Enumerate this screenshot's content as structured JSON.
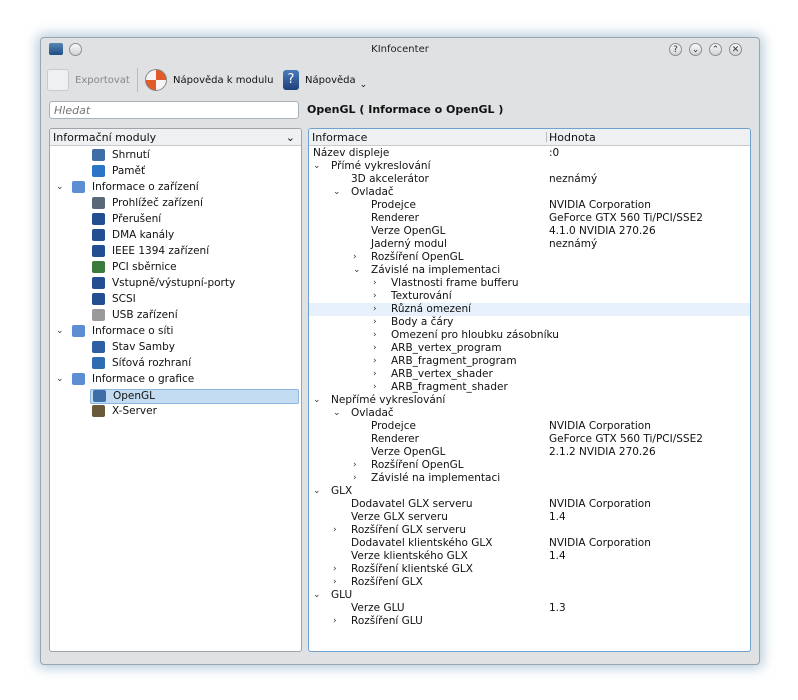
{
  "window": {
    "title": "KInfocenter"
  },
  "toolbar": {
    "export": "Exportovat",
    "module_help": "Nápověda k modulu",
    "help": "Nápověda"
  },
  "search": {
    "placeholder": "Hledat"
  },
  "page_title": "OpenGL  ( Informace o OpenGL )",
  "left": {
    "header": "Informační moduly",
    "items": [
      {
        "label": "Shrnutí",
        "level": 1,
        "icon": "monitor-icon"
      },
      {
        "label": "Paměť",
        "level": 1,
        "icon": "memory-icon"
      },
      {
        "label": "Informace o zařízení",
        "level": 0,
        "icon": "folder-icon",
        "expanded": true
      },
      {
        "label": "Prohlížeč zařízení",
        "level": 1,
        "icon": "device-icon"
      },
      {
        "label": "Přerušení",
        "level": 1,
        "icon": "info-icon"
      },
      {
        "label": "DMA kanály",
        "level": 1,
        "icon": "info-icon"
      },
      {
        "label": "IEEE 1394 zařízení",
        "level": 1,
        "icon": "info-icon"
      },
      {
        "label": "PCI sběrnice",
        "level": 1,
        "icon": "pci-icon"
      },
      {
        "label": "Vstupně/výstupní-porty",
        "level": 1,
        "icon": "info-icon"
      },
      {
        "label": "SCSI",
        "level": 1,
        "icon": "info-icon"
      },
      {
        "label": "USB zařízení",
        "level": 1,
        "icon": "usb-icon"
      },
      {
        "label": "Informace o síti",
        "level": 0,
        "icon": "folder-icon",
        "expanded": true
      },
      {
        "label": "Stav Samby",
        "level": 1,
        "icon": "samba-icon"
      },
      {
        "label": "Síťová rozhraní",
        "level": 1,
        "icon": "network-icon"
      },
      {
        "label": "Informace o grafice",
        "level": 0,
        "icon": "folder-icon",
        "expanded": true
      },
      {
        "label": "OpenGL",
        "level": 1,
        "icon": "monitor-icon",
        "selected": true
      },
      {
        "label": "X-Server",
        "level": 1,
        "icon": "x-icon"
      }
    ]
  },
  "right": {
    "col_info": "Informace",
    "col_value": "Hodnota",
    "rows": [
      {
        "label": "Název displeje",
        "value": ":0",
        "level": 0,
        "exp": ""
      },
      {
        "label": "Přímé vykreslování",
        "value": "",
        "level": 0,
        "exp": "v"
      },
      {
        "label": "3D akcelerátor",
        "value": "neznámý",
        "level": 1,
        "exp": ""
      },
      {
        "label": "Ovladač",
        "value": "",
        "level": 1,
        "exp": "v"
      },
      {
        "label": "Prodejce",
        "value": "NVIDIA Corporation",
        "level": 2,
        "exp": ""
      },
      {
        "label": "Renderer",
        "value": "GeForce GTX 560 Ti/PCI/SSE2",
        "level": 2,
        "exp": ""
      },
      {
        "label": "Verze OpenGL",
        "value": "4.1.0 NVIDIA 270.26",
        "level": 2,
        "exp": ""
      },
      {
        "label": "Jaderný modul",
        "value": "neznámý",
        "level": 2,
        "exp": ""
      },
      {
        "label": "Rozšíření OpenGL",
        "value": "",
        "level": 2,
        "exp": ">"
      },
      {
        "label": "Závislé na implementaci",
        "value": "",
        "level": 2,
        "exp": "v"
      },
      {
        "label": "Vlastnosti frame bufferu",
        "value": "",
        "level": 3,
        "exp": ">"
      },
      {
        "label": "Texturování",
        "value": "",
        "level": 3,
        "exp": ">"
      },
      {
        "label": "Různá omezení",
        "value": "",
        "level": 3,
        "exp": ">",
        "hover": true
      },
      {
        "label": "Body a čáry",
        "value": "",
        "level": 3,
        "exp": ">"
      },
      {
        "label": "Omezení pro hloubku zásobníku",
        "value": "",
        "level": 3,
        "exp": ">"
      },
      {
        "label": "ARB_vertex_program",
        "value": "",
        "level": 3,
        "exp": ">"
      },
      {
        "label": "ARB_fragment_program",
        "value": "",
        "level": 3,
        "exp": ">"
      },
      {
        "label": "ARB_vertex_shader",
        "value": "",
        "level": 3,
        "exp": ">"
      },
      {
        "label": "ARB_fragment_shader",
        "value": "",
        "level": 3,
        "exp": ">"
      },
      {
        "label": "Nepřímé vykreslování",
        "value": "",
        "level": 0,
        "exp": "v"
      },
      {
        "label": "Ovladač",
        "value": "",
        "level": 1,
        "exp": "v"
      },
      {
        "label": "Prodejce",
        "value": "NVIDIA Corporation",
        "level": 2,
        "exp": ""
      },
      {
        "label": "Renderer",
        "value": "GeForce GTX 560 Ti/PCI/SSE2",
        "level": 2,
        "exp": ""
      },
      {
        "label": "Verze OpenGL",
        "value": "2.1.2 NVIDIA 270.26",
        "level": 2,
        "exp": ""
      },
      {
        "label": "Rozšíření OpenGL",
        "value": "",
        "level": 2,
        "exp": ">"
      },
      {
        "label": "Závislé na implementaci",
        "value": "",
        "level": 2,
        "exp": ">"
      },
      {
        "label": "GLX",
        "value": "",
        "level": 0,
        "exp": "v"
      },
      {
        "label": "Dodavatel GLX serveru",
        "value": "NVIDIA Corporation",
        "level": 1,
        "exp": ""
      },
      {
        "label": "Verze GLX serveru",
        "value": "1.4",
        "level": 1,
        "exp": ""
      },
      {
        "label": "Rozšíření GLX serveru",
        "value": "",
        "level": 1,
        "exp": ">"
      },
      {
        "label": "Dodavatel klientského GLX",
        "value": "NVIDIA Corporation",
        "level": 1,
        "exp": ""
      },
      {
        "label": "Verze klientského GLX",
        "value": "1.4",
        "level": 1,
        "exp": ""
      },
      {
        "label": "Rozšíření klientské GLX",
        "value": "",
        "level": 1,
        "exp": ">"
      },
      {
        "label": "Rozšíření GLX",
        "value": "",
        "level": 1,
        "exp": ">"
      },
      {
        "label": "GLU",
        "value": "",
        "level": 0,
        "exp": "v"
      },
      {
        "label": "Verze GLU",
        "value": "1.3",
        "level": 1,
        "exp": ""
      },
      {
        "label": "Rozšíření GLU",
        "value": "",
        "level": 1,
        "exp": ">"
      }
    ]
  }
}
